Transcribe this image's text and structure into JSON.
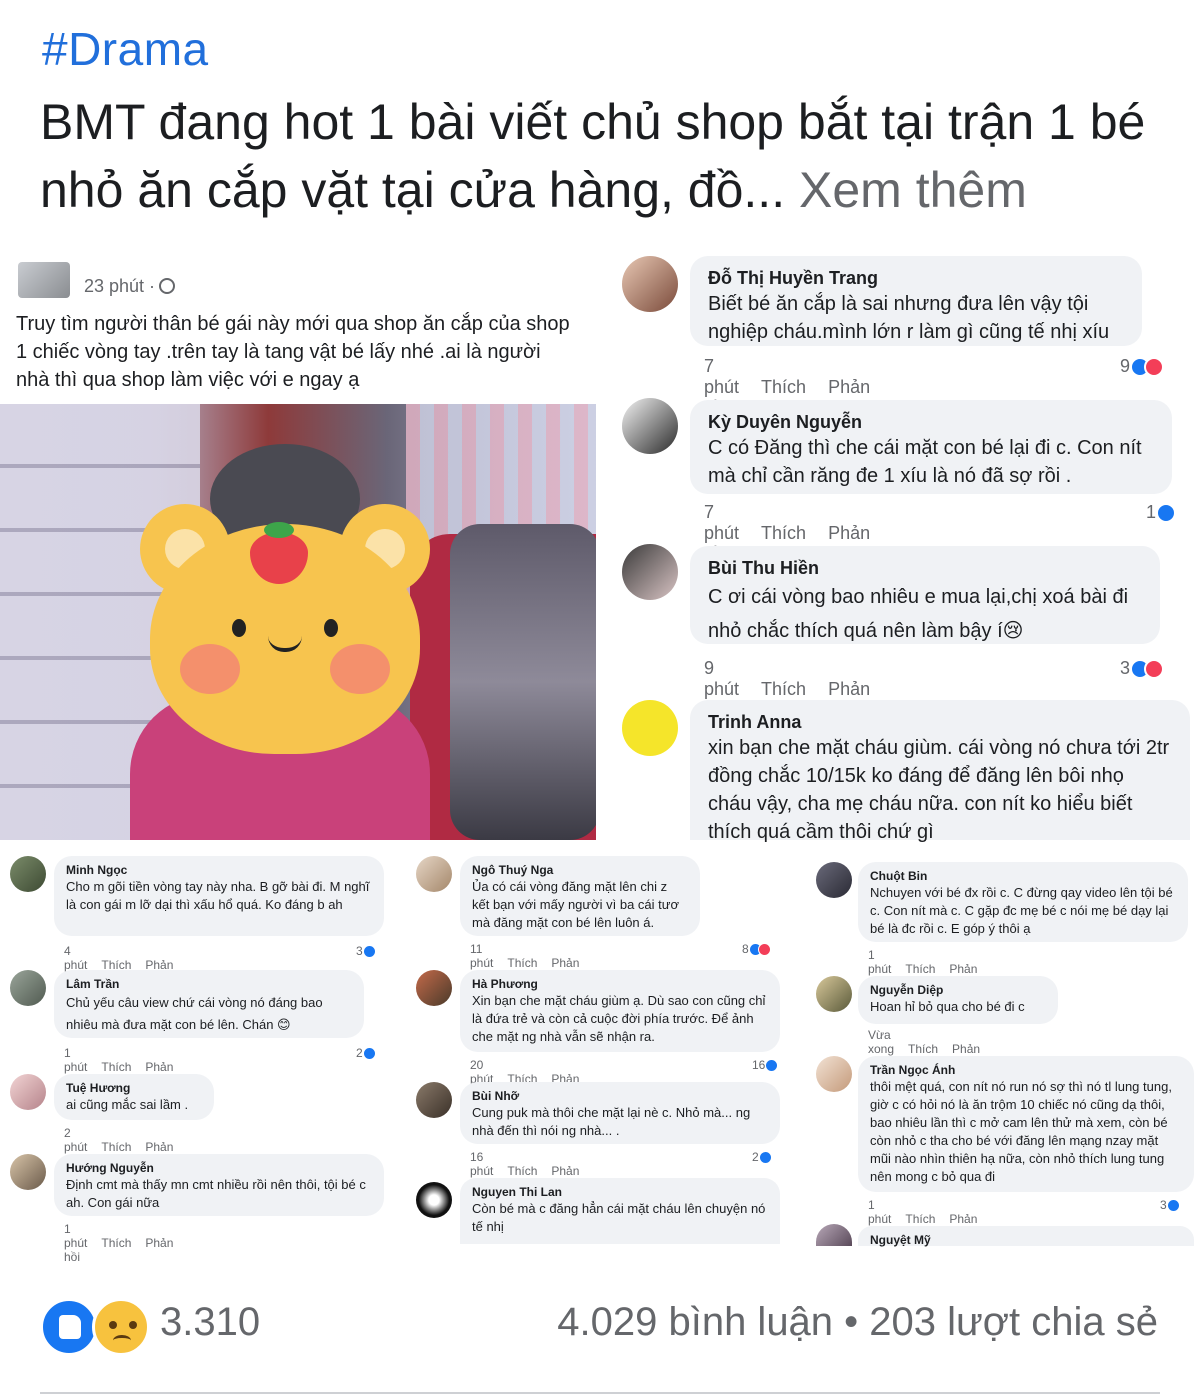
{
  "post": {
    "hashtag": "#Drama",
    "headline": "BMT đang hot 1 bài viết chủ shop bắt tại trận 1 bé nhỏ ăn cắp vặt tại cửa hàng, đồ...",
    "see_more": "Xem thêm"
  },
  "screenshot_post": {
    "time": "23 phút ·",
    "text": "Truy tìm người thân bé gái này mới qua shop ăn cắp của shop 1 chiếc vòng tay .trên tay là tang vật bé lấy nhé .ai là người nhà thì qua shop làm việc với e ngay ạ"
  },
  "big_comments": [
    {
      "name": "Đỗ Thị Huyền Trang",
      "text": "Biết bé ăn cắp là sai nhưng đưa lên vậy tội nghiệp cháu.mình lớn r làm gì cũng tế nhị xíu",
      "time": "7 phút",
      "like": "Thích",
      "reply": "Phản hồi",
      "reactions": "9"
    },
    {
      "name": "Kỳ Duyên Nguyễn",
      "text": "C có Đăng thì che cái mặt con bé lại đi c. Con nít mà chỉ cần răng đe 1 xíu là nó đã sợ rồi .",
      "time": "7 phút",
      "like": "Thích",
      "reply": "Phản hồi",
      "reactions": "1"
    },
    {
      "name": "Bùi Thu Hiền",
      "text": "C ơi cái vòng bao nhiêu e mua lại,chị xoá bài đi nhỏ chắc thích quá nên làm bậy í😢",
      "time": "9 phút",
      "like": "Thích",
      "reply": "Phản hồi",
      "reactions": "3"
    },
    {
      "name": "Trinh Anna",
      "text": "xin  bạn che mặt cháu giùm. cái vòng nó chưa tới 2tr đồng chắc 10/15k ko đáng  để đăng lên bôi nhọ cháu vậy, cha mẹ cháu nữa. con nít ko hiểu biết thích quá cầm thôi chứ gì",
      "time": "",
      "like": "",
      "reply": "",
      "reactions": ""
    }
  ],
  "small_comments": [
    {
      "name": "Minh Ngọc",
      "text": "Cho m gõi tiền vòng tay này nha. B gỡ bài đi. M nghĩ là con gái m lỡ dại thì xấu hổ quá. Ko đáng b ah",
      "time": "4 phút",
      "like": "Thích",
      "reply": "Phản hồi",
      "reactions": "3"
    },
    {
      "name": "Lâm Trần",
      "text": "Chủ yếu câu view chứ cái vòng nó đáng bao nhiêu mà đưa mặt con bé lên. Chán 😊",
      "time": "1 phút",
      "like": "Thích",
      "reply": "Phản hồi",
      "reactions": "2"
    },
    {
      "name": "Tuệ Hương",
      "text": "ai cũng mắc sai lầm .",
      "time": "2 phút",
      "like": "Thích",
      "reply": "Phản hồi",
      "reactions": ""
    },
    {
      "name": "Hướng Nguyễn",
      "text": "Định cmt mà thấy mn cmt nhiều rồi nên thôi, tội bé c ah. Con gái nữa",
      "time": "1 phút",
      "like": "Thích",
      "reply": "Phản hồi",
      "reactions": ""
    },
    {
      "name": "Ngô Thuý Nga",
      "text": "Ủa có cái vòng đăng mặt lên chi z kết bạn với mấy người vì ba cái tươ mà đăng mặt con bé lên luôn á.",
      "time": "11 phút",
      "like": "Thích",
      "reply": "Phản hồi",
      "reactions": "8"
    },
    {
      "name": "Hà Phương",
      "text": "Xin bạn che mặt cháu giùm ạ. Dù sao con cũng chỉ là đứa trẻ và còn cả cuộc đời phía trước. Để ảnh che mặt ng nhà vẫn sẽ nhận ra.",
      "time": "20 phút",
      "like": "Thích",
      "reply": "Phản hồi",
      "reactions": "16"
    },
    {
      "name": "Bùi Nhỡ",
      "text": "Cung puk mà thôi che mặt lại nè c. Nhỏ mà... ng nhà đến thì nói ng nhà... .",
      "time": "16 phút",
      "like": "Thích",
      "reply": "Phản hồi",
      "reactions": "2"
    },
    {
      "name": "Nguyen Thi Lan",
      "text": "Còn bé mà c đăng hẳn cái mặt cháu lên chuyện nó tế nhị",
      "time": "",
      "like": "",
      "reply": "",
      "reactions": ""
    },
    {
      "name": "Chuột Bin",
      "text": "Nchuyen với bé đx rồi c. C đừng qay video lên tội bé c. Con nít mà c. C gặp đc mẹ bé c nói mẹ bé dạy lại bé là đc rồi c. E góp ý thôi ạ",
      "time": "1 phút",
      "like": "Thích",
      "reply": "Phản hồi",
      "reactions": ""
    },
    {
      "name": "Nguyễn Diệp",
      "text": "Hoan hỉ bỏ qua cho bé đi c",
      "time": "Vừa xong",
      "like": "Thích",
      "reply": "Phản hồi",
      "reactions": ""
    },
    {
      "name": "Trần Ngọc Ánh",
      "text": "thôi mệt quá, con nít nó run nó sợ thì nó tl lung tung, giờ c có hỏi nó là ăn trộm 10 chiếc nó cũng dạ thôi, bao nhiêu lần thì c mở cam lên thử mà xem, còn bé còn nhỏ c tha cho bé với đăng lên mạng nzay mặt mũi nào nhìn thiên hạ nữa, còn nhỏ thích lung tung nên mong c bỏ qua đi",
      "time": "1 phút",
      "like": "Thích",
      "reply": "Phản hồi",
      "reactions": "3"
    },
    {
      "name": "Nguyệt Mỹ",
      "text": "",
      "time": "",
      "like": "",
      "reply": "",
      "reactions": ""
    }
  ],
  "footer": {
    "reactions_count": "3.310",
    "stats": "4.029 bình luận • 203 lượt chia sẻ"
  },
  "colors": {
    "hashtag": "#216fdb",
    "like": "#1877f2",
    "love": "#f33e58",
    "bubble": "#f0f2f5"
  }
}
